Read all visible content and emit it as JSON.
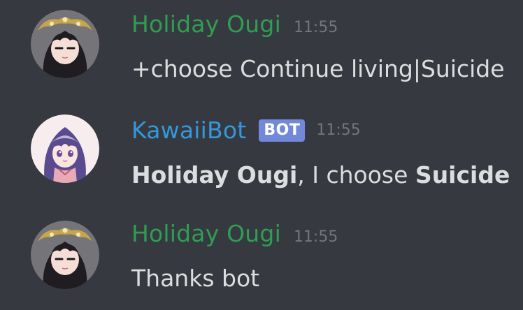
{
  "messages": [
    {
      "author": "Holiday Ougi",
      "author_color": "#2f9e52",
      "timestamp": "11:55",
      "text": "+choose Continue living|Suicide"
    },
    {
      "author": "KawaiiBot",
      "author_color": "#3498db",
      "bot_tag": "BOT",
      "bot_tag_color": "#7289da",
      "timestamp": "11:55",
      "mention": "Holiday Ougi",
      "middle": ", I choose ",
      "choice": "Suicide"
    },
    {
      "author": "Holiday Ougi",
      "author_color": "#2f9e52",
      "timestamp": "11:55",
      "text": "Thanks bot"
    }
  ],
  "colors": {
    "background": "#36393f",
    "message_text": "#dcddde",
    "timestamp": "#72767d"
  },
  "icons": {
    "holiday_avatar": "dark-haired-anime-girl-avatar",
    "kawaiibot_avatar": "purple-haired-anime-girl-avatar"
  }
}
